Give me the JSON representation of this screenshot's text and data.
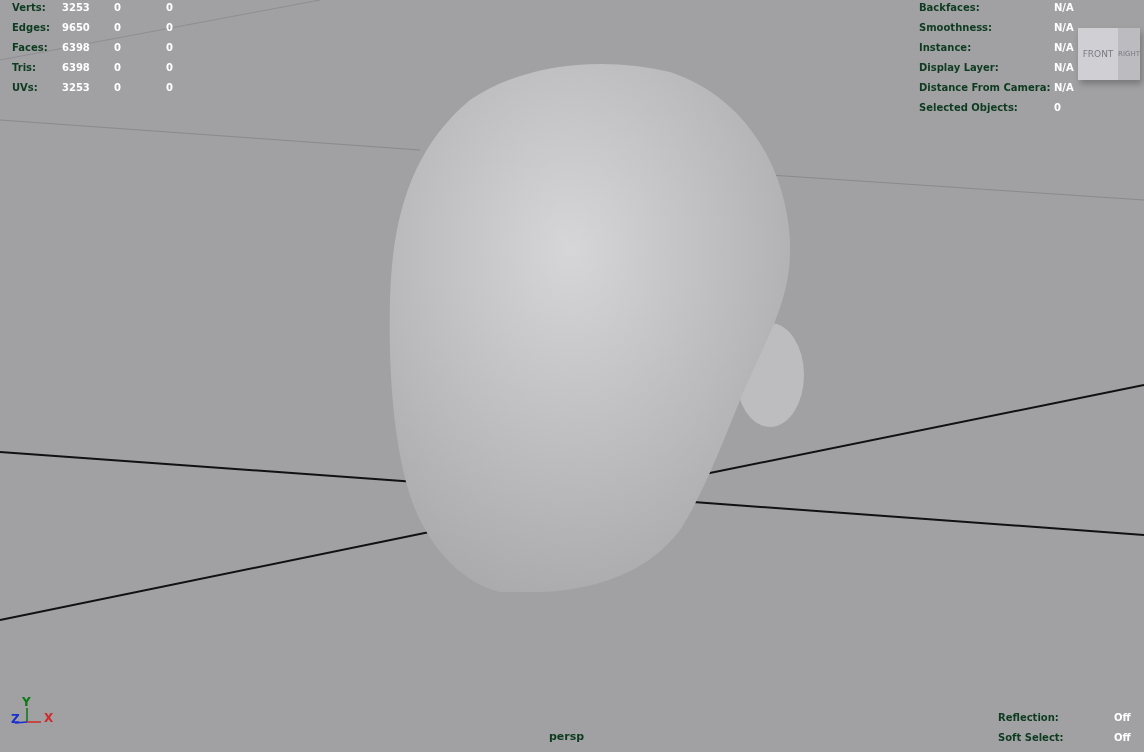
{
  "hud_left": {
    "rows": [
      {
        "label": "Verts:",
        "values": [
          "3253",
          "0",
          "0"
        ]
      },
      {
        "label": "Edges:",
        "values": [
          "9650",
          "0",
          "0"
        ]
      },
      {
        "label": "Faces:",
        "values": [
          "6398",
          "0",
          "0"
        ]
      },
      {
        "label": "Tris:",
        "values": [
          "6398",
          "0",
          "0"
        ]
      },
      {
        "label": "UVs:",
        "values": [
          "3253",
          "0",
          "0"
        ]
      }
    ]
  },
  "hud_right": {
    "rows": [
      {
        "label": "Backfaces:",
        "value": "N/A"
      },
      {
        "label": "Smoothness:",
        "value": "N/A"
      },
      {
        "label": "Instance:",
        "value": "N/A"
      },
      {
        "label": "Display Layer:",
        "value": "N/A"
      },
      {
        "label": "Distance From Camera:",
        "value": "N/A"
      },
      {
        "label": "Selected Objects:",
        "value": "0"
      }
    ]
  },
  "view_cube": {
    "faces": [
      "FRONT",
      "RIGHT"
    ]
  },
  "axis_gizmo": {
    "axes": [
      {
        "label": "Y",
        "color": "#0a7a12"
      },
      {
        "label": "Z",
        "color": "#1a2fd0"
      },
      {
        "label": "X",
        "color": "#d02a2a"
      }
    ]
  },
  "camera_label": "persp",
  "hud_bottom_right": {
    "rows": [
      {
        "label": "Reflection:",
        "value": "Off"
      },
      {
        "label": "Soft Select:",
        "value": "Off"
      }
    ]
  }
}
